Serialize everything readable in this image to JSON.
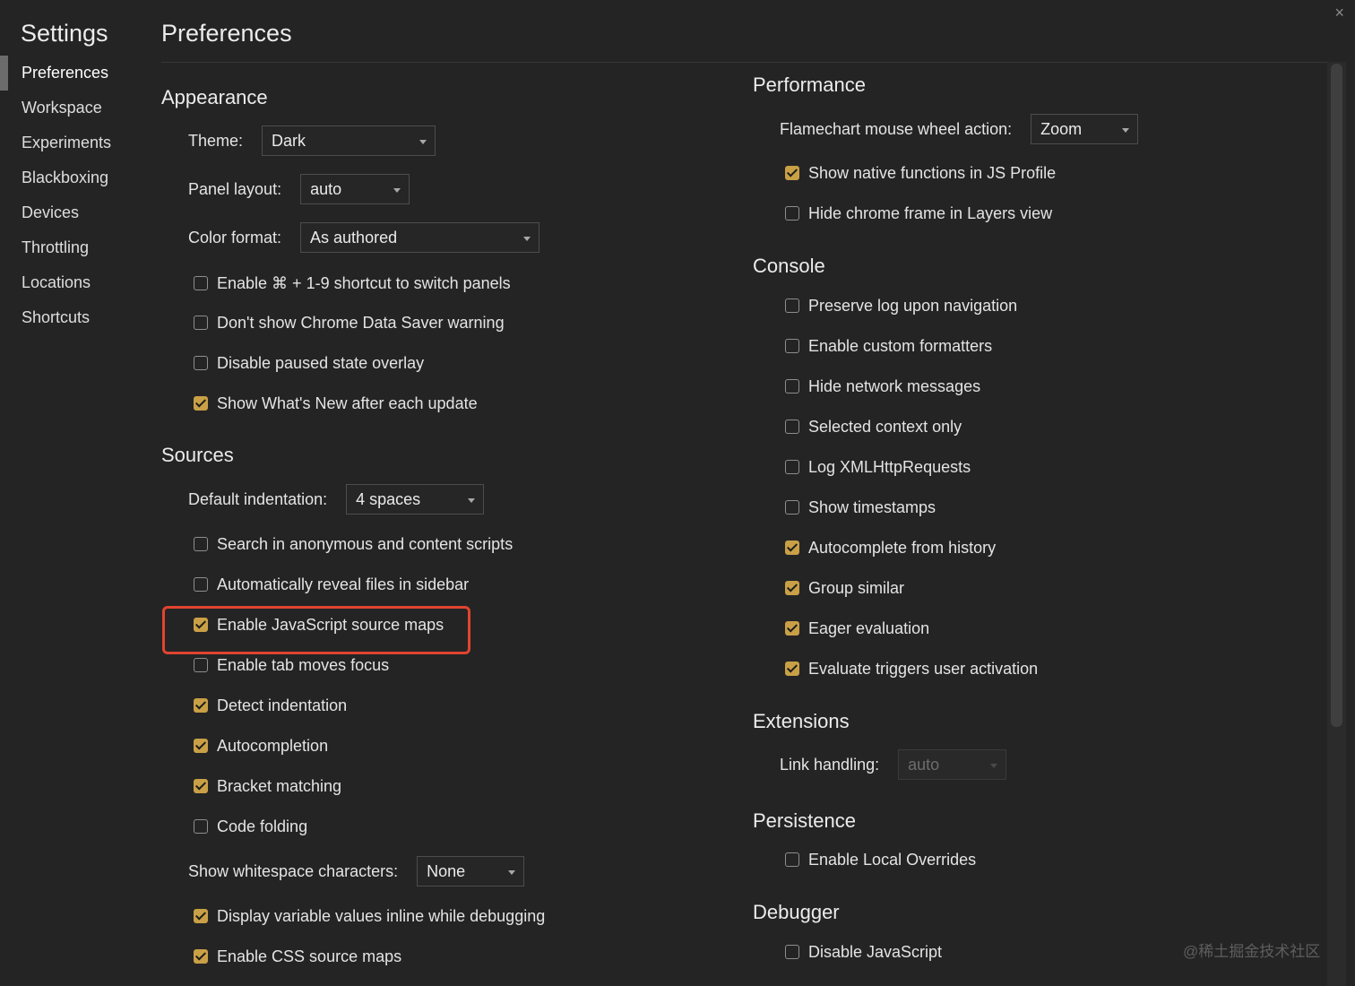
{
  "window": {
    "close_glyph": "×"
  },
  "sidebar": {
    "title": "Settings",
    "items": [
      {
        "label": "Preferences",
        "active": true
      },
      {
        "label": "Workspace"
      },
      {
        "label": "Experiments"
      },
      {
        "label": "Blackboxing"
      },
      {
        "label": "Devices"
      },
      {
        "label": "Throttling"
      },
      {
        "label": "Locations"
      },
      {
        "label": "Shortcuts"
      }
    ]
  },
  "page": {
    "title": "Preferences"
  },
  "appearance": {
    "title": "Appearance",
    "theme": {
      "label": "Theme:",
      "value": "Dark"
    },
    "panel_layout": {
      "label": "Panel layout:",
      "value": "auto"
    },
    "color_format": {
      "label": "Color format:",
      "value": "As authored"
    },
    "checks": [
      {
        "label": "Enable ⌘ + 1-9 shortcut to switch panels",
        "checked": false
      },
      {
        "label": "Don't show Chrome Data Saver warning",
        "checked": false
      },
      {
        "label": "Disable paused state overlay",
        "checked": false
      },
      {
        "label": "Show What's New after each update",
        "checked": true
      }
    ]
  },
  "sources": {
    "title": "Sources",
    "default_indentation": {
      "label": "Default indentation:",
      "value": "4 spaces"
    },
    "checks": [
      {
        "label": "Search in anonymous and content scripts",
        "checked": false
      },
      {
        "label": "Automatically reveal files in sidebar",
        "checked": false
      },
      {
        "label": "Enable JavaScript source maps",
        "checked": true,
        "highlighted": true
      },
      {
        "label": "Enable tab moves focus",
        "checked": false
      },
      {
        "label": "Detect indentation",
        "checked": true
      },
      {
        "label": "Autocompletion",
        "checked": true
      },
      {
        "label": "Bracket matching",
        "checked": true
      },
      {
        "label": "Code folding",
        "checked": false
      }
    ],
    "whitespace": {
      "label": "Show whitespace characters:",
      "value": "None"
    },
    "checks_after": [
      {
        "label": "Display variable values inline while debugging",
        "checked": true
      },
      {
        "label": "Enable CSS source maps",
        "checked": true
      }
    ]
  },
  "performance": {
    "title": "Performance",
    "flamechart": {
      "label": "Flamechart mouse wheel action:",
      "value": "Zoom"
    },
    "checks": [
      {
        "label": "Show native functions in JS Profile",
        "checked": true
      },
      {
        "label": "Hide chrome frame in Layers view",
        "checked": false
      }
    ]
  },
  "console": {
    "title": "Console",
    "checks": [
      {
        "label": "Preserve log upon navigation",
        "checked": false
      },
      {
        "label": "Enable custom formatters",
        "checked": false
      },
      {
        "label": "Hide network messages",
        "checked": false
      },
      {
        "label": "Selected context only",
        "checked": false
      },
      {
        "label": "Log XMLHttpRequests",
        "checked": false
      },
      {
        "label": "Show timestamps",
        "checked": false
      },
      {
        "label": "Autocomplete from history",
        "checked": true
      },
      {
        "label": "Group similar",
        "checked": true
      },
      {
        "label": "Eager evaluation",
        "checked": true
      },
      {
        "label": "Evaluate triggers user activation",
        "checked": true
      }
    ]
  },
  "extensions": {
    "title": "Extensions",
    "link_handling": {
      "label": "Link handling:",
      "value": "auto",
      "disabled": true
    }
  },
  "persistence": {
    "title": "Persistence",
    "checks": [
      {
        "label": "Enable Local Overrides",
        "checked": false
      }
    ]
  },
  "debugger": {
    "title": "Debugger",
    "checks": [
      {
        "label": "Disable JavaScript",
        "checked": false
      }
    ]
  },
  "watermark": {
    "text": "@稀土掘金技术社区"
  },
  "colors": {
    "accent": "#c9a046",
    "highlight": "#e0442f",
    "background": "#242424"
  },
  "icons": {
    "close": "close-icon",
    "caret": "chevron-down-icon",
    "checkmark": "checkmark-icon"
  }
}
